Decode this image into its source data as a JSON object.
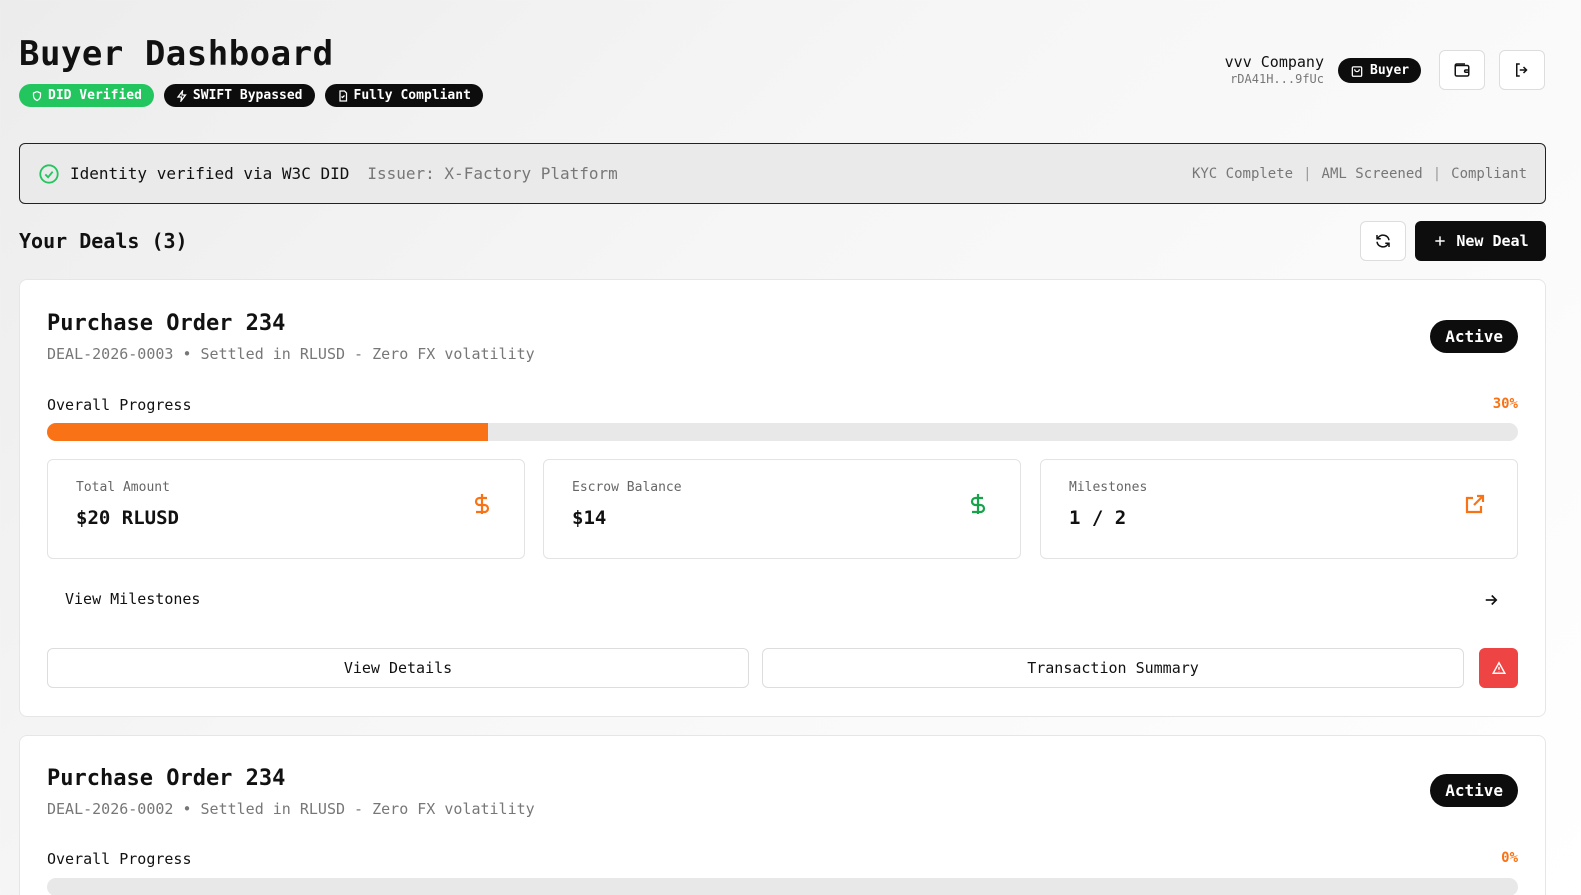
{
  "header": {
    "title": "Buyer Dashboard",
    "badges": [
      {
        "label": "DID Verified",
        "icon": "shield-icon",
        "color": "#22c55e"
      },
      {
        "label": "SWIFT Bypassed",
        "icon": "bolt-icon",
        "color": "#0d0d0d"
      },
      {
        "label": "Fully Compliant",
        "icon": "document-icon",
        "color": "#0d0d0d"
      }
    ],
    "company_name": "vvv Company",
    "wallet_address": "rDA41H...9fUc",
    "role": "Buyer",
    "role_icon": "shopping-bag-icon",
    "wallet_icon": "wallet-icon",
    "logout_icon": "logout-icon"
  },
  "identity": {
    "text": "Identity verified via W3C DID",
    "issuer": "Issuer: X-Factory Platform",
    "checks": [
      "KYC Complete",
      "AML Screened",
      "Compliant"
    ],
    "separator": "|",
    "icon": "check-circle-icon",
    "icon_color": "#22c55e"
  },
  "deals": {
    "title": "Your Deals (3)",
    "new_deal_label": "New Deal",
    "items": [
      {
        "name": "Purchase Order 234",
        "meta": "DEAL-2026-0003 • Settled in RLUSD - Zero FX volatility",
        "status": "Active",
        "progress_label": "Overall Progress",
        "progress_text": "30%",
        "progress_value": 0.3,
        "stats": [
          {
            "label": "Total Amount",
            "value": "$20 RLUSD",
            "icon": "dollar-icon",
            "icon_color": "#f97316"
          },
          {
            "label": "Escrow Balance",
            "value": "$14",
            "icon": "dollar-icon",
            "icon_color": "#16a34a"
          },
          {
            "label": "Milestones",
            "value": "1 / 2",
            "icon": "external-link-icon",
            "icon_color": "#f97316"
          }
        ],
        "view_milestones": "View Milestones",
        "view_details": "View Details",
        "transaction_summary": "Transaction Summary"
      },
      {
        "name": "Purchase Order 234",
        "meta": "DEAL-2026-0002 • Settled in RLUSD - Zero FX volatility",
        "status": "Active",
        "progress_label": "Overall Progress",
        "progress_text": "0%",
        "progress_value": 0
      }
    ]
  },
  "colors": {
    "accent": "#f97316",
    "success": "#22c55e",
    "danger": "#ef4444",
    "dark": "#0d0d0d"
  }
}
